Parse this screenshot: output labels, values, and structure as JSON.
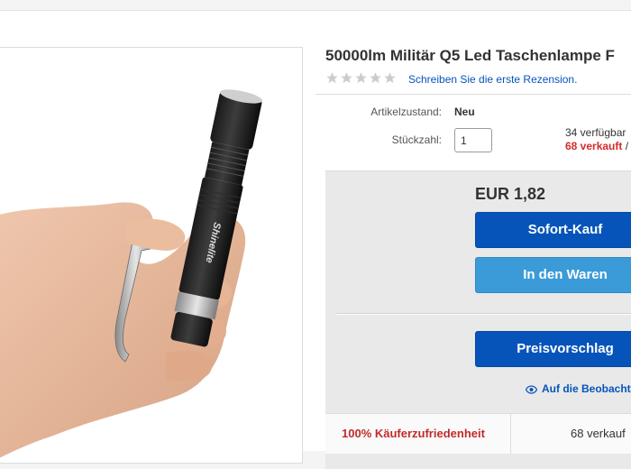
{
  "product": {
    "title": "50000lm Militär Q5 Led Taschenlampe F",
    "rating_stars": 0,
    "rating_max": 5,
    "review_link": "Schreiben Sie die erste Rezension."
  },
  "details": {
    "condition_label": "Artikelzustand:",
    "condition_value": "Neu",
    "quantity_label": "Stückzahl:",
    "quantity_value": "1",
    "available_text": "34 verfügbar",
    "sold_text": "68 verkauft",
    "sold_suffix": " /"
  },
  "buybox": {
    "price": "EUR 1,82",
    "buy_now_label": "Sofort-Kauf",
    "cart_label": "In den Waren",
    "offer_label": "Preisvorschlag",
    "watch_label": "Auf die Beobacht",
    "watch_icon": "eye-icon"
  },
  "footer": {
    "satisfaction": "100% Käuferzufriedenheit",
    "sold_count": "68 verkauf"
  },
  "colors": {
    "link_blue": "#0654ba",
    "cart_blue": "#3a9bd8",
    "sold_red": "#d42a2a",
    "star_gray": "#cccccc"
  },
  "image": {
    "depicts": "hand holding black LED flashlight with pocket clip",
    "engraving": "Shinelite"
  }
}
